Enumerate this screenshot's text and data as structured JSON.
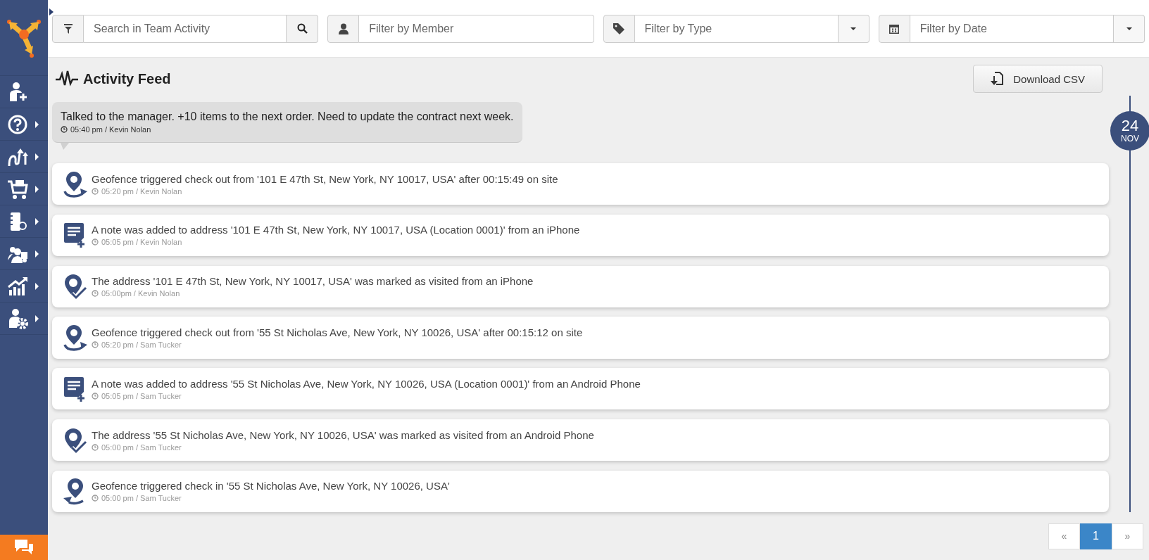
{
  "sidebar": {
    "items": [
      {
        "kind": "add-user",
        "submenu": false
      },
      {
        "kind": "help",
        "submenu": true
      },
      {
        "kind": "routes",
        "submenu": true
      },
      {
        "kind": "cart",
        "submenu": true
      },
      {
        "kind": "notebook",
        "submenu": true
      },
      {
        "kind": "team",
        "submenu": true
      },
      {
        "kind": "reports",
        "submenu": true
      },
      {
        "kind": "settings",
        "submenu": true
      }
    ]
  },
  "filters": [
    {
      "kind": "search",
      "placeholder": "Search in Team Activity"
    },
    {
      "kind": "member",
      "placeholder": "Filter by Member"
    },
    {
      "kind": "type",
      "placeholder": "Filter by Type"
    },
    {
      "kind": "date",
      "placeholder": "Filter by Date"
    }
  ],
  "feed": {
    "title": "Activity Feed",
    "download_button": "Download CSV",
    "comment": {
      "text": "Talked to the manager. +10 items to the next order. Need to update the contract next week.",
      "meta": "05:40 pm / Kevin Nolan"
    },
    "date_marker": {
      "day": "24",
      "month": "NOV"
    },
    "entries": [
      {
        "kind": "checkout",
        "text": "Geofence triggered check out from '101 E 47th St, New York, NY 10017, USA' after 00:15:49 on site",
        "meta": "05:20 pm / Kevin Nolan"
      },
      {
        "kind": "note",
        "text": "A note was added to address '101 E 47th St, New York, NY 10017, USA (Location 0001)' from an iPhone",
        "meta": "05:05 pm / Kevin Nolan"
      },
      {
        "kind": "visited",
        "text": "The address '101 E 47th St, New York, NY 10017, USA' was marked as visited from an iPhone",
        "meta": "05:00pm / Kevin Nolan"
      },
      {
        "kind": "checkout",
        "text": "Geofence triggered check out from '55 St Nicholas Ave, New York, NY 10026, USA' after 00:15:12 on site",
        "meta": "05:20 pm / Sam Tucker"
      },
      {
        "kind": "note",
        "text": "A note was added to address '55 St Nicholas Ave, New York, NY 10026, USA (Location 0001)' from an Android Phone",
        "meta": "05:05 pm / Sam Tucker"
      },
      {
        "kind": "visited",
        "text": "The address '55 St Nicholas Ave, New York, NY 10026, USA' was marked as visited from an Android Phone",
        "meta": "05:00 pm / Sam Tucker"
      },
      {
        "kind": "checkin",
        "text": "Geofence triggered check in '55 St Nicholas Ave, New York, NY 10026, USA'",
        "meta": "05:00 pm / Sam Tucker"
      }
    ]
  },
  "pagination": {
    "prev": "«",
    "next": "»",
    "pages": [
      {
        "label": "1",
        "selected": true
      }
    ]
  }
}
